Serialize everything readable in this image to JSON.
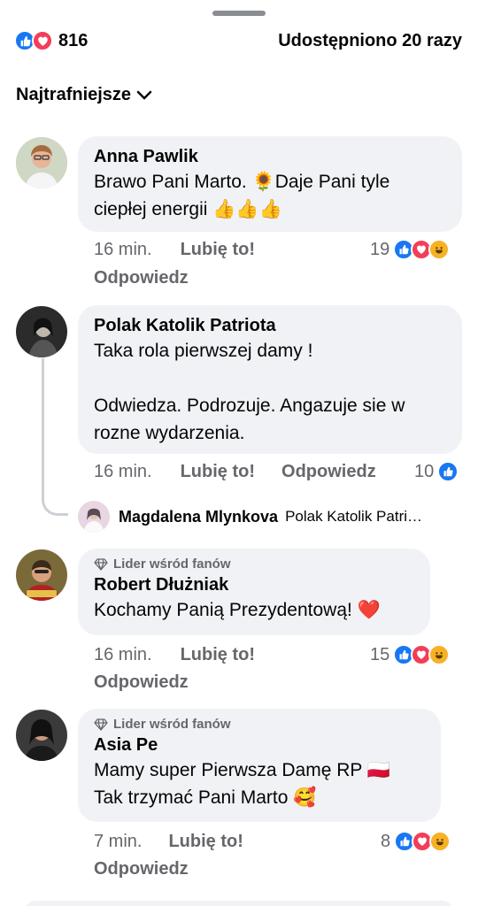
{
  "post": {
    "reaction_count": "816",
    "shares": "Udostępniono 20 razy",
    "sort_label": "Najtrafniejsze"
  },
  "icons": {
    "like": "like-icon",
    "love": "love-icon",
    "haha": "haha-icon",
    "fan_badge": "diamond-icon",
    "chevron": "chevron-down-icon"
  },
  "colors": {
    "like": "#1877f2",
    "love": "#f33e58",
    "haha": "#f7b125",
    "bubble": "#f0f2f5",
    "muted": "#65676b"
  },
  "comments": [
    {
      "author": "Anna Pawlik",
      "text": "Brawo Pani Marto. 🌻Daje Pani tyle ciepłej energii 👍👍👍",
      "time": "16 min.",
      "like": "Lubię to!",
      "reply": "Odpowiedz",
      "reactions": "19"
    },
    {
      "author": "Polak Katolik Patriota",
      "text": "Taka rola pierwszej damy !\n\nOdwiedza. Podrozuje. Angazuje sie w rozne wydarzenia.",
      "time": "16 min.",
      "like": "Lubię to!",
      "reply": "Odpowiedz",
      "reactions": "10",
      "reply_preview": {
        "author": "Magdalena Mlynkova",
        "snippet": "Polak Katolik Patri…"
      }
    },
    {
      "badge": "Lider wśród fanów",
      "author": "Robert Dłużniak",
      "text": "Kochamy Panią Prezydentową! ❤️",
      "time": "16 min.",
      "like": "Lubię to!",
      "reply": "Odpowiedz",
      "reactions": "15"
    },
    {
      "badge": "Lider wśród fanów",
      "author": "Asia Pe",
      "text": "Mamy super Pierwsza Damę RP 🇵🇱\nTak trzymać Pani Marto 🥰",
      "time": "7 min.",
      "like": "Lubię to!",
      "reply": "Odpowiedz",
      "reactions": "8"
    }
  ]
}
